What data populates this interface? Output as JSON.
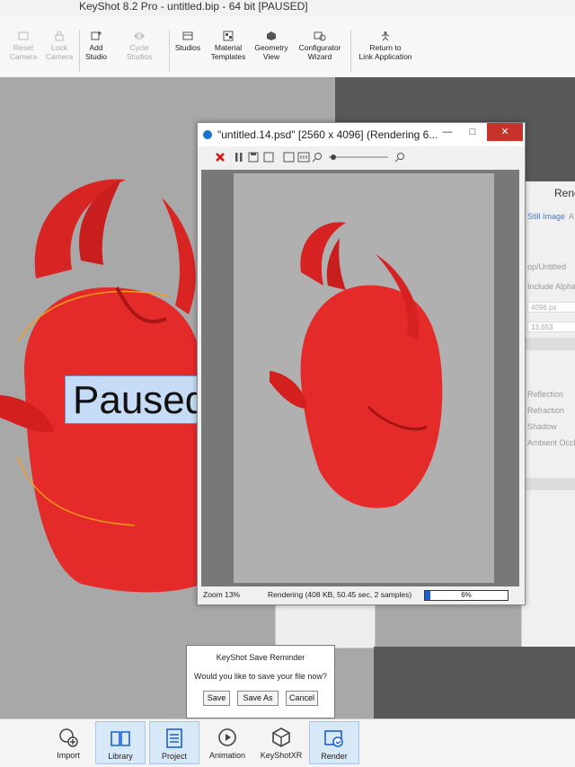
{
  "window": {
    "title": "KeyShot 8.2 Pro  - untitled.bip  - 64 bit [PAUSED]"
  },
  "toolbar": {
    "items": [
      {
        "label1": "Reset",
        "label2": "Camera",
        "icon": "reset-camera-icon"
      },
      {
        "label1": "Lock",
        "label2": "Camera",
        "icon": "lock-camera-icon"
      },
      {
        "label1": "Add",
        "label2": "Studio",
        "icon": "add-studio-icon"
      },
      {
        "label1": "Cycle",
        "label2": "Studios",
        "icon": "cycle-studios-icon"
      },
      {
        "label1": "Studios",
        "label2": "",
        "icon": "studios-icon"
      },
      {
        "label1": "Material",
        "label2": "Templates",
        "icon": "material-templates-icon"
      },
      {
        "label1": "Geometry",
        "label2": "View",
        "icon": "geometry-view-icon"
      },
      {
        "label1": "Configurator",
        "label2": "Wizard",
        "icon": "configurator-wizard-icon"
      },
      {
        "label1": "Return to",
        "label2": "Link Application",
        "icon": "return-link-icon"
      }
    ]
  },
  "viewport": {
    "paused_label": "Paused"
  },
  "render_settings": {
    "title": "Rend",
    "tab_still": "Still Image",
    "tab_anim": "A",
    "folder": "op/Untitled",
    "include_alpha": "Include Alpha",
    "width_px": "4096 px",
    "size_val": "13,653",
    "opts": [
      "Reflection",
      "Refraction",
      "Shadow",
      "Ambient Occl"
    ]
  },
  "render_window": {
    "title": "\"untitled.14.psd\" [2560 x 4096] (Rendering 6...",
    "min": "—",
    "max": "□",
    "close": "✕",
    "zoom": "Zoom 13%",
    "status": "Rendering (408 KB, 50.45 sec, 2 samples)",
    "progress_label": "6%",
    "progress_fraction": 0.06
  },
  "reminder": {
    "title": "KeyShot Save Reminder",
    "question": "Would you like to save your file now?",
    "save": "Save",
    "save_as": "Save As",
    "cancel": "Cancel"
  },
  "bottom": {
    "items": [
      {
        "label": "Import",
        "icon": "import-icon"
      },
      {
        "label": "Library",
        "icon": "library-icon"
      },
      {
        "label": "Project",
        "icon": "project-icon"
      },
      {
        "label": "Animation",
        "icon": "animation-icon"
      },
      {
        "label": "KeyShotXR",
        "icon": "keyshotxr-icon"
      },
      {
        "label": "Render",
        "icon": "render-icon"
      }
    ]
  },
  "colors": {
    "model_red": "#e52a2a",
    "accent_blue": "#1d5fd6",
    "close_red": "#c7322b"
  }
}
